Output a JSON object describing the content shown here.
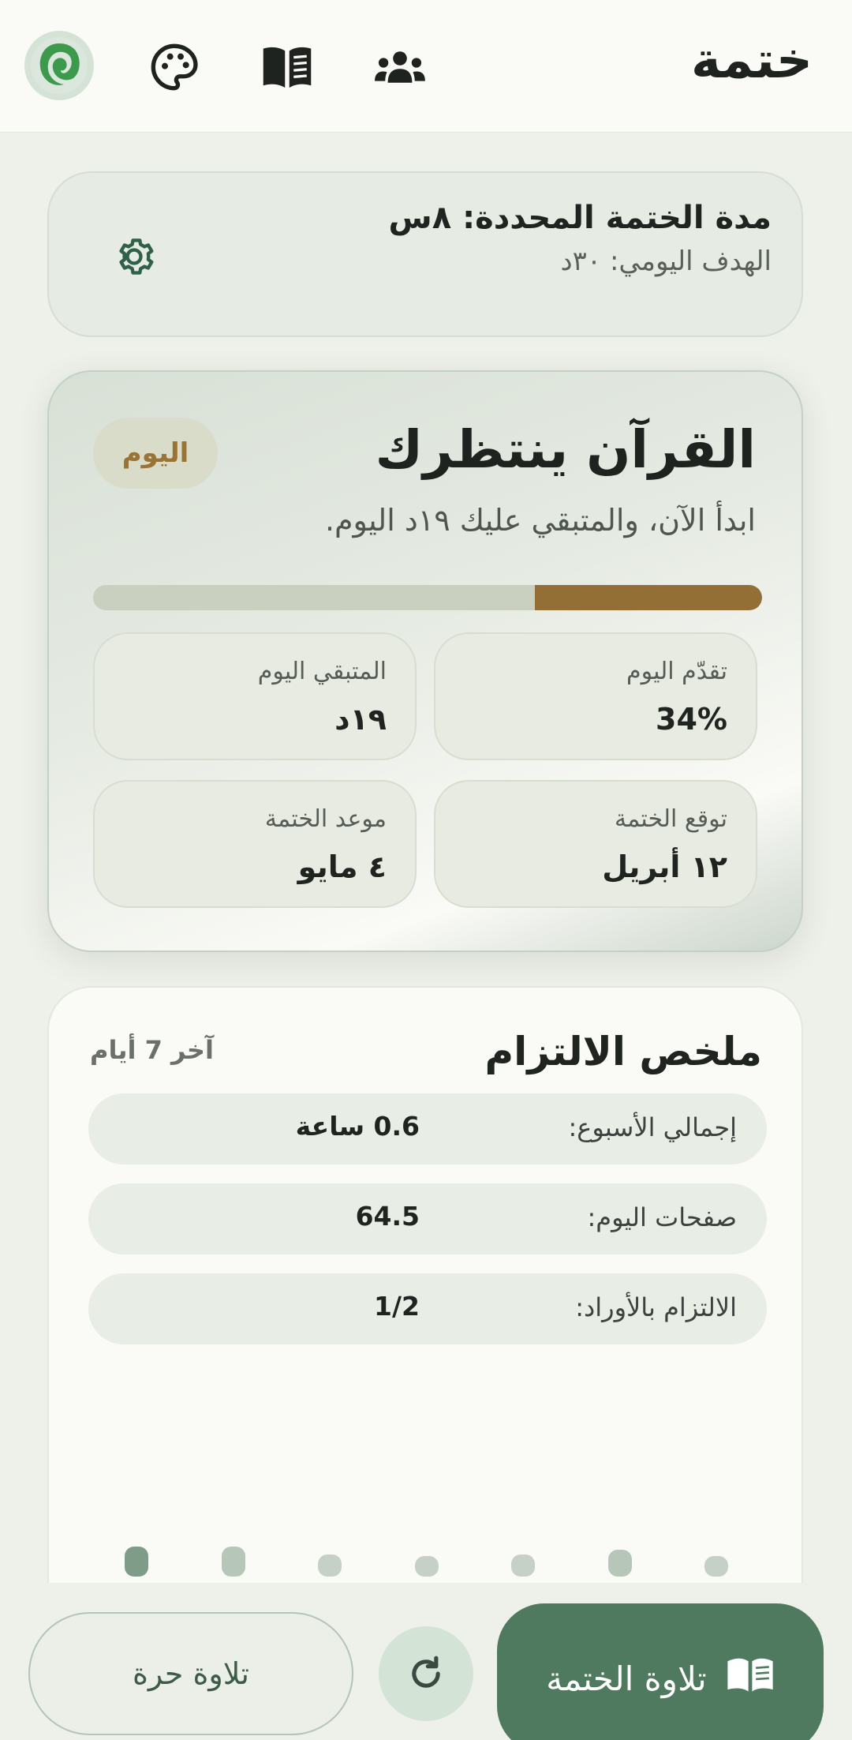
{
  "colors": {
    "primary": "#4f7a60",
    "accent_gold": "#936e35",
    "background": "#eef0ea"
  },
  "header": {
    "title": "ختمة",
    "icons": [
      "logo",
      "palette-icon",
      "book-icon",
      "group-icon"
    ]
  },
  "goal": {
    "title": "مدة الختمة المحددة: ٨س",
    "daily_target": "الهدف اليومي: ٣٠د"
  },
  "hero": {
    "title": "القرآن ينتظرك",
    "badge": "اليوم",
    "subtitle": "ابدأ الآن، والمتبقي عليك ١٩د اليوم.",
    "progress_percent": 34,
    "stats": [
      {
        "label": "تقدّم اليوم",
        "value": "34%"
      },
      {
        "label": "المتبقي اليوم",
        "value": "١٩د"
      },
      {
        "label": "توقع الختمة",
        "value": "١٢ أبريل"
      },
      {
        "label": "موعد الختمة",
        "value": "٤ مايو"
      }
    ]
  },
  "summary": {
    "title": "ملخص الالتزام",
    "range": "آخر 7 أيام",
    "rows": [
      {
        "label": "إجمالي الأسبوع:",
        "value": "0.6 ساعة"
      },
      {
        "label": "صفحات اليوم:",
        "value": "64.5"
      },
      {
        "label": "الالتزام بالأوراد:",
        "value": "1/2"
      }
    ]
  },
  "actions": {
    "free_recitation": "تلاوة حرة",
    "khatma_recitation": "تلاوة الختمة"
  }
}
